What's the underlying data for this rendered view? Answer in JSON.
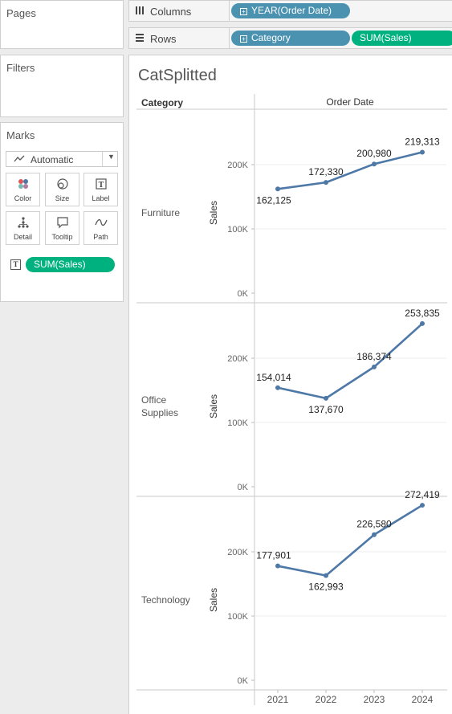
{
  "panels": {
    "pages_title": "Pages",
    "filters_title": "Filters",
    "marks_title": "Marks"
  },
  "marks": {
    "type_label": "Automatic",
    "buttons": [
      {
        "label": "Color",
        "icon": "color-dots-icon"
      },
      {
        "label": "Size",
        "icon": "size-icon"
      },
      {
        "label": "Label",
        "icon": "text-label-icon"
      },
      {
        "label": "Detail",
        "icon": "detail-icon"
      },
      {
        "label": "Tooltip",
        "icon": "tooltip-icon"
      },
      {
        "label": "Path",
        "icon": "path-icon"
      }
    ],
    "field_pill": "SUM(Sales)"
  },
  "shelves": {
    "columns_label": "Columns",
    "rows_label": "Rows",
    "column_pill": "YEAR(Order Date)",
    "row_pill_category": "Category",
    "row_pill_sales": "SUM(Sales)"
  },
  "sheet_title": "CatSplitted",
  "colors": {
    "line": "#4e79a7",
    "dimension_pill": "#4a92b0",
    "measure_pill": "#00b180"
  },
  "chart_data": {
    "type": "line",
    "row_header": "Category",
    "column_header": "Order Date",
    "ylabel": "Sales",
    "x": [
      "2021",
      "2022",
      "2023",
      "2024"
    ],
    "ylim": [
      0,
      280000
    ],
    "yticks": [
      0,
      100000,
      200000
    ],
    "ytick_labels": [
      "0K",
      "100K",
      "200K"
    ],
    "series": [
      {
        "name": "Furniture",
        "label_lines": [
          "Furniture"
        ],
        "values": [
          162125,
          172330,
          200980,
          219313
        ],
        "value_labels": [
          "162,125",
          "172,330",
          "200,980",
          "219,313"
        ]
      },
      {
        "name": "Office Supplies",
        "label_lines": [
          "Office",
          "Supplies"
        ],
        "values": [
          154014,
          137670,
          186374,
          253835
        ],
        "value_labels": [
          "154,014",
          "137,670",
          "186,374",
          "253,835"
        ]
      },
      {
        "name": "Technology",
        "label_lines": [
          "Technology"
        ],
        "values": [
          177901,
          162993,
          226580,
          272419
        ],
        "value_labels": [
          "177,901",
          "162,993",
          "226,580",
          "272,419"
        ]
      }
    ]
  }
}
